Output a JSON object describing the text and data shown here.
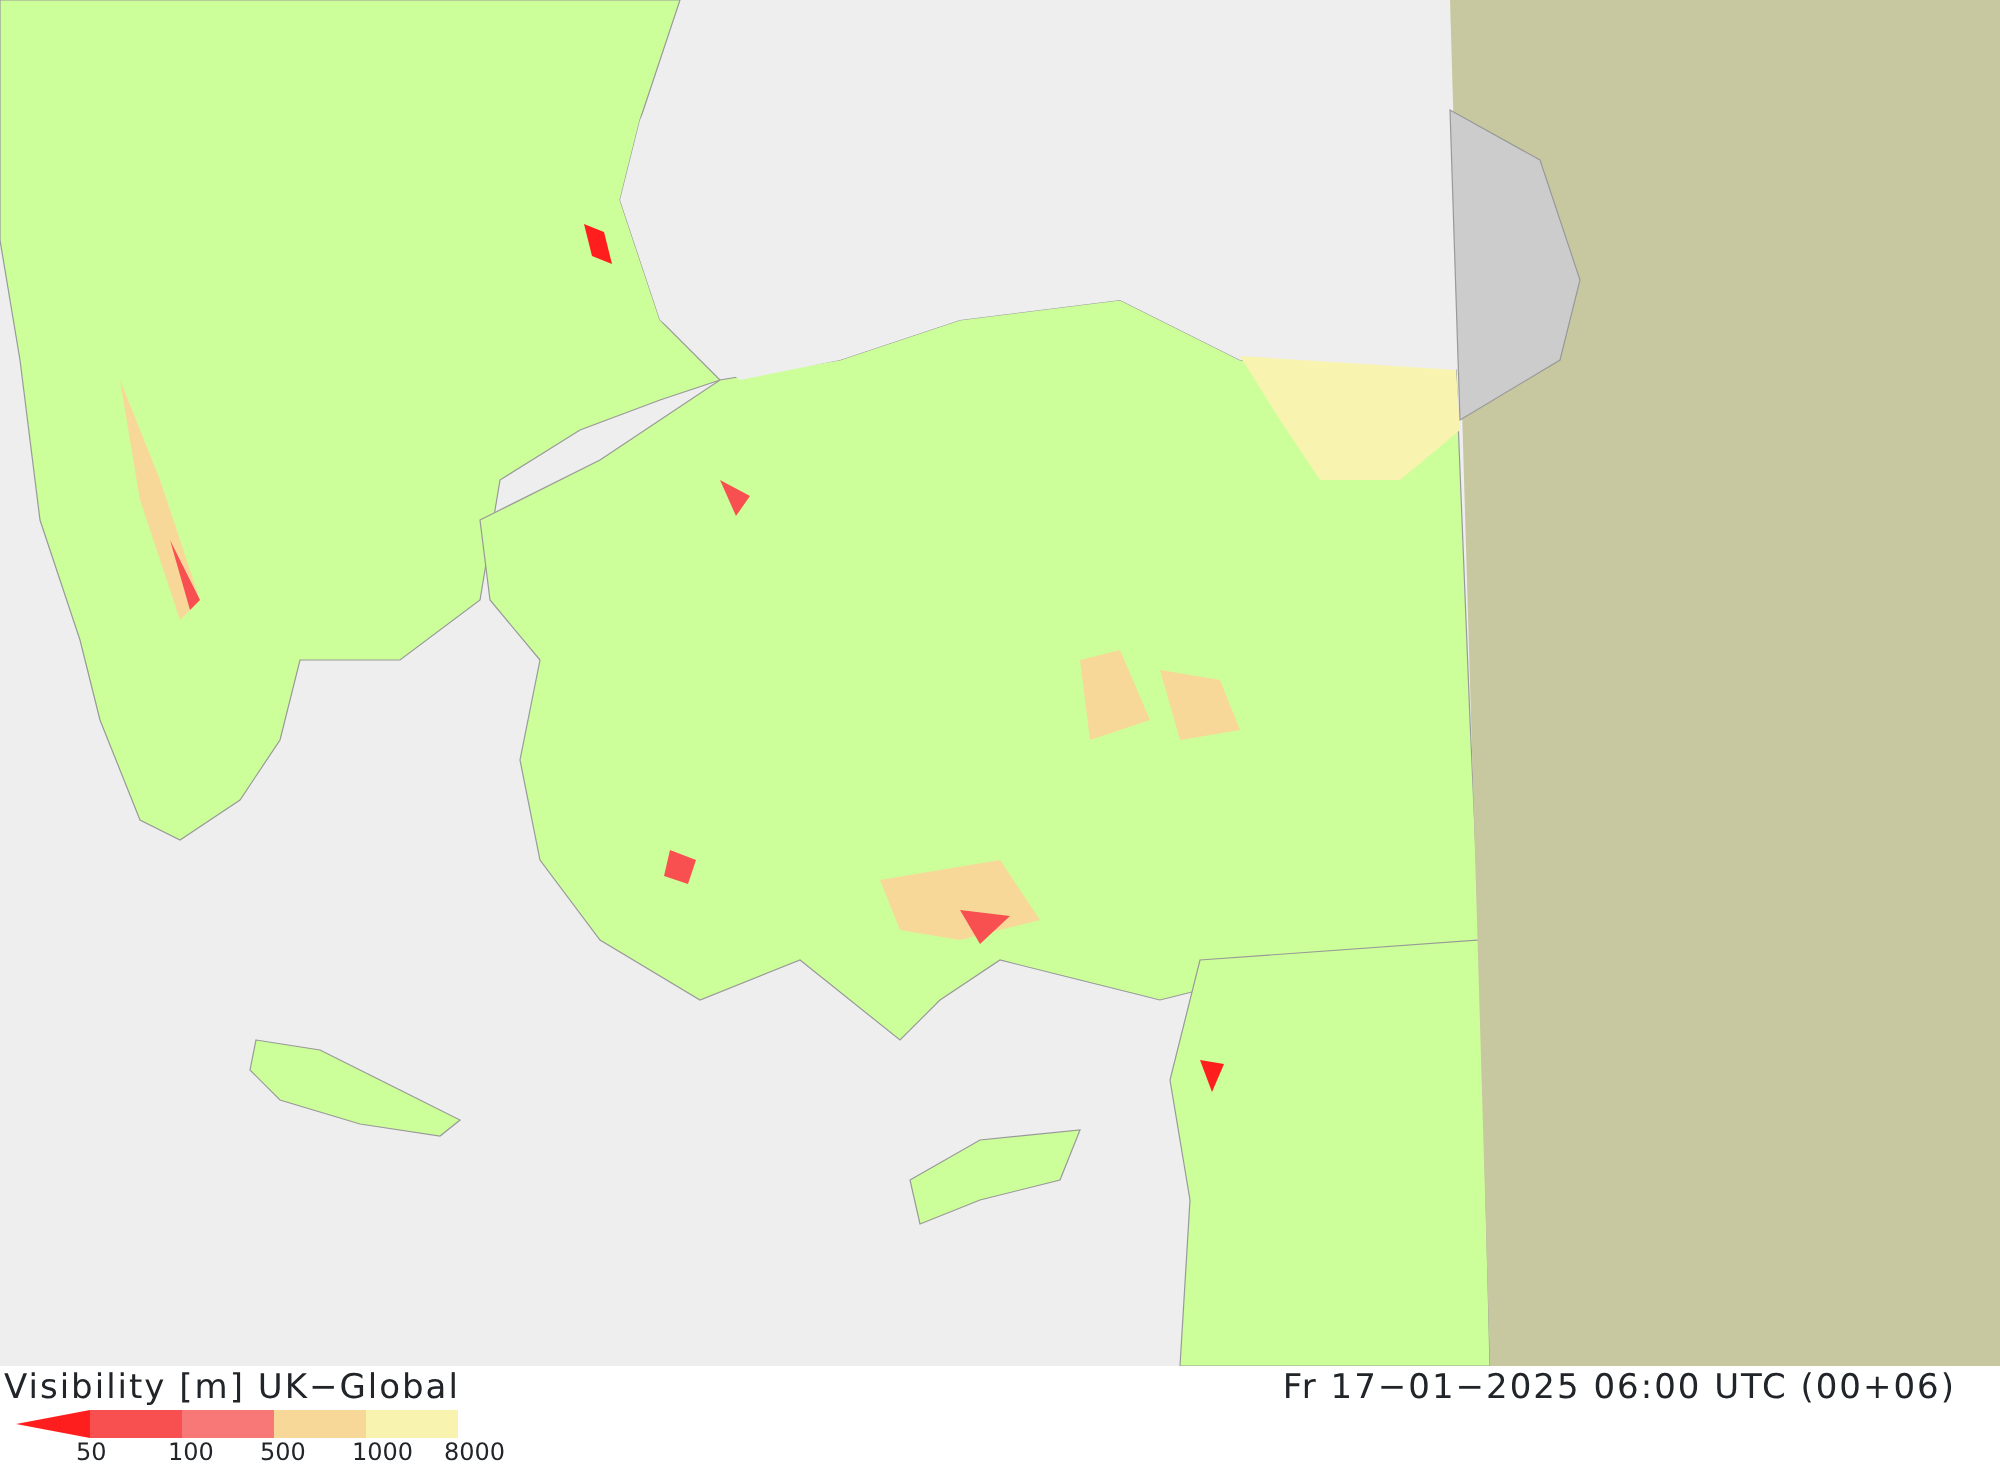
{
  "map": {
    "title": "Visibility [m] UK−Global",
    "valid_time": "Fr 17−01−2025 06:00 UTC (00+06)"
  },
  "legend": {
    "classes": [
      {
        "color": "#ff1e1e",
        "kind": "arrow"
      },
      {
        "color": "#f85050",
        "kind": "box"
      },
      {
        "color": "#f87878",
        "kind": "box"
      },
      {
        "color": "#f8d898",
        "kind": "box"
      },
      {
        "color": "#f8f4b0",
        "kind": "box"
      }
    ],
    "ticks": [
      "50",
      "100",
      "500",
      "1000",
      "8000"
    ]
  }
}
